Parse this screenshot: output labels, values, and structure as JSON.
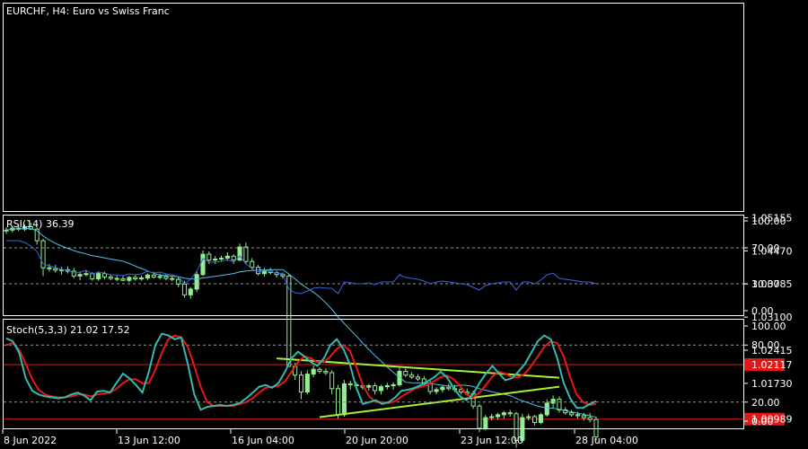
{
  "colors": {
    "background": "#000000",
    "bull": "#90ee90",
    "bear": "#000000",
    "wick": "#90ee90",
    "ma": "#4fc3e8",
    "hline": "#e01818",
    "label_bg": "#e01818",
    "trend": "#a8f030",
    "rsi": "#3a66e0",
    "stoch_main": "#35b9b0",
    "stoch_signal": "#e81818",
    "text": "#ffffff",
    "grid": "#9a9a9a"
  },
  "chart_data": [
    {
      "type": "candlestick",
      "title": "EURCHF, H4:  Euro vs Swiss Franc",
      "ylim": [
        1.094,
        1.0535
      ],
      "yticks": [
        "1.05155",
        "1.04470",
        "1.03785",
        "1.03100",
        "1.02415",
        "1.01730"
      ],
      "ytick_values": [
        1.05155,
        1.0447,
        1.03785,
        1.031,
        1.02415,
        1.0173
      ],
      "price_lines": [
        {
          "value": 1.02117,
          "label": "1.02117"
        },
        {
          "value": 1.00989,
          "label": "1.00989"
        }
      ],
      "ma_period_note": "moving average",
      "trendlines": [
        {
          "from": [
            0,
            1.02245
          ],
          "to": [
            0,
            1.01845
          ]
        },
        {
          "from": [
            0,
            1.0103
          ],
          "to": [
            0,
            1.0166
          ]
        }
      ],
      "candles": [
        [
          1.0488,
          1.0496,
          1.0482,
          1.049
        ],
        [
          1.049,
          1.0498,
          1.0485,
          1.0494
        ],
        [
          1.0494,
          1.05,
          1.0488,
          1.0492
        ],
        [
          1.0492,
          1.0502,
          1.0488,
          1.0497
        ],
        [
          1.0497,
          1.0505,
          1.049,
          1.0492
        ],
        [
          1.0492,
          1.0495,
          1.046,
          1.0468
        ],
        [
          1.0468,
          1.0472,
          1.0395,
          1.0412
        ],
        [
          1.0412,
          1.042,
          1.0404,
          1.041
        ],
        [
          1.041,
          1.0418,
          1.0402,
          1.0407
        ],
        [
          1.0407,
          1.0414,
          1.0398,
          1.0408
        ],
        [
          1.0408,
          1.0415,
          1.04,
          1.0405
        ],
        [
          1.0405,
          1.0412,
          1.039,
          1.0395
        ],
        [
          1.0395,
          1.0404,
          1.0386,
          1.0398
        ],
        [
          1.0398,
          1.0406,
          1.0394,
          1.04
        ],
        [
          1.04,
          1.0403,
          1.0385,
          1.0389
        ],
        [
          1.0389,
          1.0405,
          1.0385,
          1.04
        ],
        [
          1.04,
          1.0404,
          1.0388,
          1.0393
        ],
        [
          1.0393,
          1.0398,
          1.0386,
          1.039
        ],
        [
          1.039,
          1.0396,
          1.0384,
          1.0389
        ],
        [
          1.0389,
          1.0395,
          1.0384,
          1.0386
        ],
        [
          1.0386,
          1.0395,
          1.0382,
          1.0392
        ],
        [
          1.0392,
          1.0398,
          1.0385,
          1.0389
        ],
        [
          1.0389,
          1.0396,
          1.0385,
          1.0391
        ],
        [
          1.0391,
          1.04,
          1.0386,
          1.0397
        ],
        [
          1.0397,
          1.0404,
          1.039,
          1.0393
        ],
        [
          1.0393,
          1.04,
          1.0388,
          1.0394
        ],
        [
          1.0394,
          1.0398,
          1.0386,
          1.039
        ],
        [
          1.039,
          1.0396,
          1.0384,
          1.0388
        ],
        [
          1.0388,
          1.0394,
          1.0372,
          1.0378
        ],
        [
          1.0378,
          1.0385,
          1.035,
          1.0356
        ],
        [
          1.0356,
          1.0372,
          1.0348,
          1.0368
        ],
        [
          1.0368,
          1.0405,
          1.0362,
          1.0398
        ],
        [
          1.0398,
          1.0448,
          1.0395,
          1.044
        ],
        [
          1.044,
          1.0446,
          1.042,
          1.0428
        ],
        [
          1.0428,
          1.0436,
          1.042,
          1.043
        ],
        [
          1.043,
          1.0437,
          1.0425,
          1.0432
        ],
        [
          1.0432,
          1.0444,
          1.0426,
          1.0436
        ],
        [
          1.0436,
          1.044,
          1.042,
          1.0428
        ],
        [
          1.0428,
          1.0462,
          1.0425,
          1.0455
        ],
        [
          1.0455,
          1.0464,
          1.042,
          1.0425
        ],
        [
          1.0425,
          1.0432,
          1.0408,
          1.0413
        ],
        [
          1.0413,
          1.0418,
          1.0396,
          1.04
        ],
        [
          1.04,
          1.0412,
          1.0394,
          1.0405
        ],
        [
          1.0405,
          1.0412,
          1.0398,
          1.0402
        ],
        [
          1.0402,
          1.0406,
          1.0392,
          1.0398
        ],
        [
          1.0398,
          1.0402,
          1.039,
          1.0395
        ],
        [
          1.0395,
          1.0398,
          1.025,
          1.0208
        ],
        [
          1.0208,
          1.0215,
          1.018,
          1.019
        ],
        [
          1.019,
          1.0198,
          1.014,
          1.0155
        ],
        [
          1.0155,
          1.02,
          1.015,
          1.0192
        ],
        [
          1.0192,
          1.021,
          1.0186,
          1.0202
        ],
        [
          1.0202,
          1.0206,
          1.0193,
          1.0198
        ],
        [
          1.0198,
          1.0204,
          1.019,
          1.0195
        ],
        [
          1.0195,
          1.02,
          1.015,
          1.0162
        ],
        [
          1.0162,
          1.017,
          1.01,
          1.0108
        ],
        [
          1.0108,
          1.018,
          1.0104,
          1.0172
        ],
        [
          1.0172,
          1.0178,
          1.016,
          1.017
        ],
        [
          1.017,
          1.0175,
          1.0162,
          1.0168
        ],
        [
          1.0168,
          1.0175,
          1.016,
          1.0165
        ],
        [
          1.0165,
          1.0172,
          1.0158,
          1.0168
        ],
        [
          1.0168,
          1.0174,
          1.015,
          1.0158
        ],
        [
          1.0158,
          1.017,
          1.015,
          1.0166
        ],
        [
          1.0166,
          1.0174,
          1.016,
          1.0168
        ],
        [
          1.0168,
          1.0175,
          1.016,
          1.017
        ],
        [
          1.017,
          1.0205,
          1.0166,
          1.0198
        ],
        [
          1.0198,
          1.0204,
          1.0186,
          1.019
        ],
        [
          1.019,
          1.0196,
          1.0182,
          1.0186
        ],
        [
          1.0186,
          1.0192,
          1.0178,
          1.0182
        ],
        [
          1.0182,
          1.0188,
          1.0168,
          1.0172
        ],
        [
          1.0172,
          1.0178,
          1.015,
          1.0156
        ],
        [
          1.0156,
          1.0165,
          1.015,
          1.016
        ],
        [
          1.016,
          1.0168,
          1.0154,
          1.0165
        ],
        [
          1.0165,
          1.0172,
          1.0158,
          1.0162
        ],
        [
          1.0162,
          1.017,
          1.0155,
          1.016
        ],
        [
          1.016,
          1.0166,
          1.015,
          1.0155
        ],
        [
          1.0155,
          1.0162,
          1.0148,
          1.0152
        ],
        [
          1.0152,
          1.0158,
          1.012,
          1.0126
        ],
        [
          1.0126,
          1.013,
          1.0072,
          1.008
        ],
        [
          1.008,
          1.0108,
          1.0076,
          1.0102
        ],
        [
          1.0102,
          1.011,
          1.0096,
          1.0104
        ],
        [
          1.0104,
          1.0112,
          1.0098,
          1.0108
        ],
        [
          1.0108,
          1.0116,
          1.01,
          1.0112
        ],
        [
          1.0112,
          1.0118,
          1.0104,
          1.011
        ],
        [
          1.011,
          1.0114,
          1.004,
          1.0055
        ],
        [
          1.0055,
          1.011,
          1.005,
          1.0102
        ],
        [
          1.0102,
          1.011,
          1.0096,
          1.0104
        ],
        [
          1.0104,
          1.0108,
          1.0086,
          1.0092
        ],
        [
          1.0092,
          1.0112,
          1.0088,
          1.0108
        ],
        [
          1.0108,
          1.014,
          1.0104,
          1.0132
        ],
        [
          1.0132,
          1.0148,
          1.0122,
          1.014
        ],
        [
          1.014,
          1.0146,
          1.0112,
          1.0118
        ],
        [
          1.0118,
          1.0124,
          1.0108,
          1.0112
        ],
        [
          1.0112,
          1.0118,
          1.0104,
          1.0108
        ],
        [
          1.0108,
          1.0114,
          1.01,
          1.0106
        ],
        [
          1.0106,
          1.0112,
          1.0096,
          1.0102
        ],
        [
          1.0102,
          1.0112,
          1.0092,
          1.0098
        ],
        [
          1.0098,
          1.0104,
          1.0055,
          1.0062
        ]
      ]
    },
    {
      "type": "line",
      "title": "RSI(14) 36.39",
      "ylim": [
        0,
        100
      ],
      "yticks": [
        "100.00",
        "70.00",
        "30.00",
        "0.00"
      ],
      "ytick_values": [
        100,
        70,
        30,
        0
      ],
      "levels": [
        70,
        30
      ],
      "values": [
        78,
        78,
        78,
        76,
        72,
        66,
        52,
        50,
        48,
        46,
        45,
        42,
        43,
        45,
        41,
        43,
        42,
        40,
        40,
        39,
        41,
        40,
        41,
        44,
        42,
        43,
        41,
        40,
        38,
        30,
        35,
        44,
        58,
        54,
        54,
        55,
        57,
        54,
        61,
        52,
        47,
        43,
        45,
        44,
        42,
        41,
        24,
        20,
        19,
        22,
        25,
        26,
        25,
        25,
        19,
        32,
        31,
        30,
        30,
        31,
        29,
        32,
        32,
        32,
        40,
        37,
        36,
        35,
        33,
        30,
        32,
        33,
        32,
        31,
        30,
        29,
        26,
        23,
        28,
        30,
        31,
        32,
        32,
        23,
        32,
        32,
        30,
        34,
        40,
        42,
        36,
        35,
        34,
        33,
        32,
        32,
        30
      ]
    },
    {
      "type": "line",
      "title": "Stoch(5,3,3) 21.02 17.52",
      "ylim": [
        0,
        100
      ],
      "yticks": [
        "100.00",
        "80.00",
        "20.00",
        "0.00"
      ],
      "ytick_values": [
        100,
        80,
        20,
        0
      ],
      "levels": [
        80,
        20
      ],
      "series": [
        {
          "name": "main",
          "values": [
            87,
            84,
            72,
            45,
            32,
            28,
            26,
            25,
            24,
            25,
            28,
            30,
            27,
            22,
            31,
            32,
            30,
            40,
            50,
            45,
            38,
            30,
            52,
            80,
            92,
            90,
            86,
            88,
            60,
            28,
            12,
            15,
            16,
            17,
            16,
            17,
            19,
            24,
            30,
            36,
            38,
            35,
            40,
            52,
            66,
            73,
            68,
            62,
            58,
            66,
            80,
            86,
            76,
            60,
            35,
            18,
            20,
            22,
            18,
            20,
            25,
            32,
            33,
            35,
            38,
            42,
            46,
            52,
            46,
            35,
            26,
            22,
            28,
            40,
            50,
            58,
            50,
            43,
            45,
            52,
            60,
            72,
            84,
            90,
            86,
            66,
            40,
            24,
            14,
            14,
            18,
            21
          ]
        },
        {
          "name": "signal",
          "values": [
            80,
            82,
            75,
            60,
            44,
            33,
            28,
            26,
            25,
            25,
            26,
            28,
            28,
            26,
            28,
            29,
            30,
            34,
            40,
            44,
            44,
            40,
            40,
            54,
            72,
            86,
            90,
            88,
            78,
            58,
            36,
            20,
            16,
            16,
            16,
            16,
            18,
            20,
            24,
            30,
            35,
            36,
            37,
            42,
            52,
            62,
            68,
            66,
            62,
            62,
            68,
            76,
            80,
            74,
            57,
            38,
            26,
            20,
            20,
            19,
            21,
            26,
            30,
            34,
            36,
            38,
            42,
            46,
            48,
            44,
            37,
            28,
            25,
            30,
            38,
            47,
            52,
            50,
            46,
            46,
            50,
            58,
            68,
            78,
            84,
            82,
            68,
            46,
            28,
            20,
            17,
            18
          ]
        }
      ]
    }
  ],
  "x_axis": {
    "labels": [
      "8 Jun 2022",
      "13 Jun 12:00",
      "16 Jun 04:00",
      "20 Jun 20:00",
      "23 Jun 12:00",
      "28 Jun 04:00"
    ],
    "label_indices": [
      0,
      20,
      40,
      60,
      80,
      100
    ]
  }
}
